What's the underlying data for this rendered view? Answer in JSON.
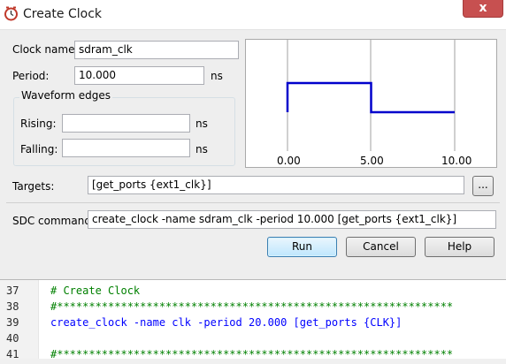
{
  "window": {
    "title": "Create Clock",
    "close_label": "x"
  },
  "form": {
    "clock_name_label": "Clock name:",
    "clock_name_value": "sdram_clk",
    "period_label": "Period:",
    "period_value": "10.000",
    "period_unit": "ns",
    "waveform_group_label": "Waveform edges",
    "rising_label": "Rising:",
    "rising_value": "",
    "rising_unit": "ns",
    "falling_label": "Falling:",
    "falling_value": "",
    "falling_unit": "ns",
    "targets_label": "Targets:",
    "targets_value": "[get_ports {ext1_clk}]",
    "browse_label": "...",
    "sdc_label": "SDC command:",
    "sdc_value": "create_clock -name sdram_clk -period 10.000 [get_ports {ext1_clk}]"
  },
  "waveform": {
    "ticks": [
      "0.00",
      "5.00",
      "10.00"
    ],
    "high_from": 0.0,
    "high_to": 5.0,
    "period": 10.0,
    "line_color": "#0000cc"
  },
  "buttons": {
    "run": "Run",
    "cancel": "Cancel",
    "help": "Help"
  },
  "editor": {
    "lines": [
      {
        "num": "37",
        "text": "# Create Clock"
      },
      {
        "num": "38",
        "text": "#**************************************************************"
      },
      {
        "num": "39",
        "text": "create_clock -name clk -period 20.000 [get_ports {CLK}]"
      },
      {
        "num": "40",
        "text": ""
      },
      {
        "num": "41",
        "text": "#**************************************************************"
      }
    ],
    "colors": {
      "comment": "#008000",
      "command": "#0000ff",
      "bracket": "#c0a000",
      "text": "#000000"
    }
  }
}
